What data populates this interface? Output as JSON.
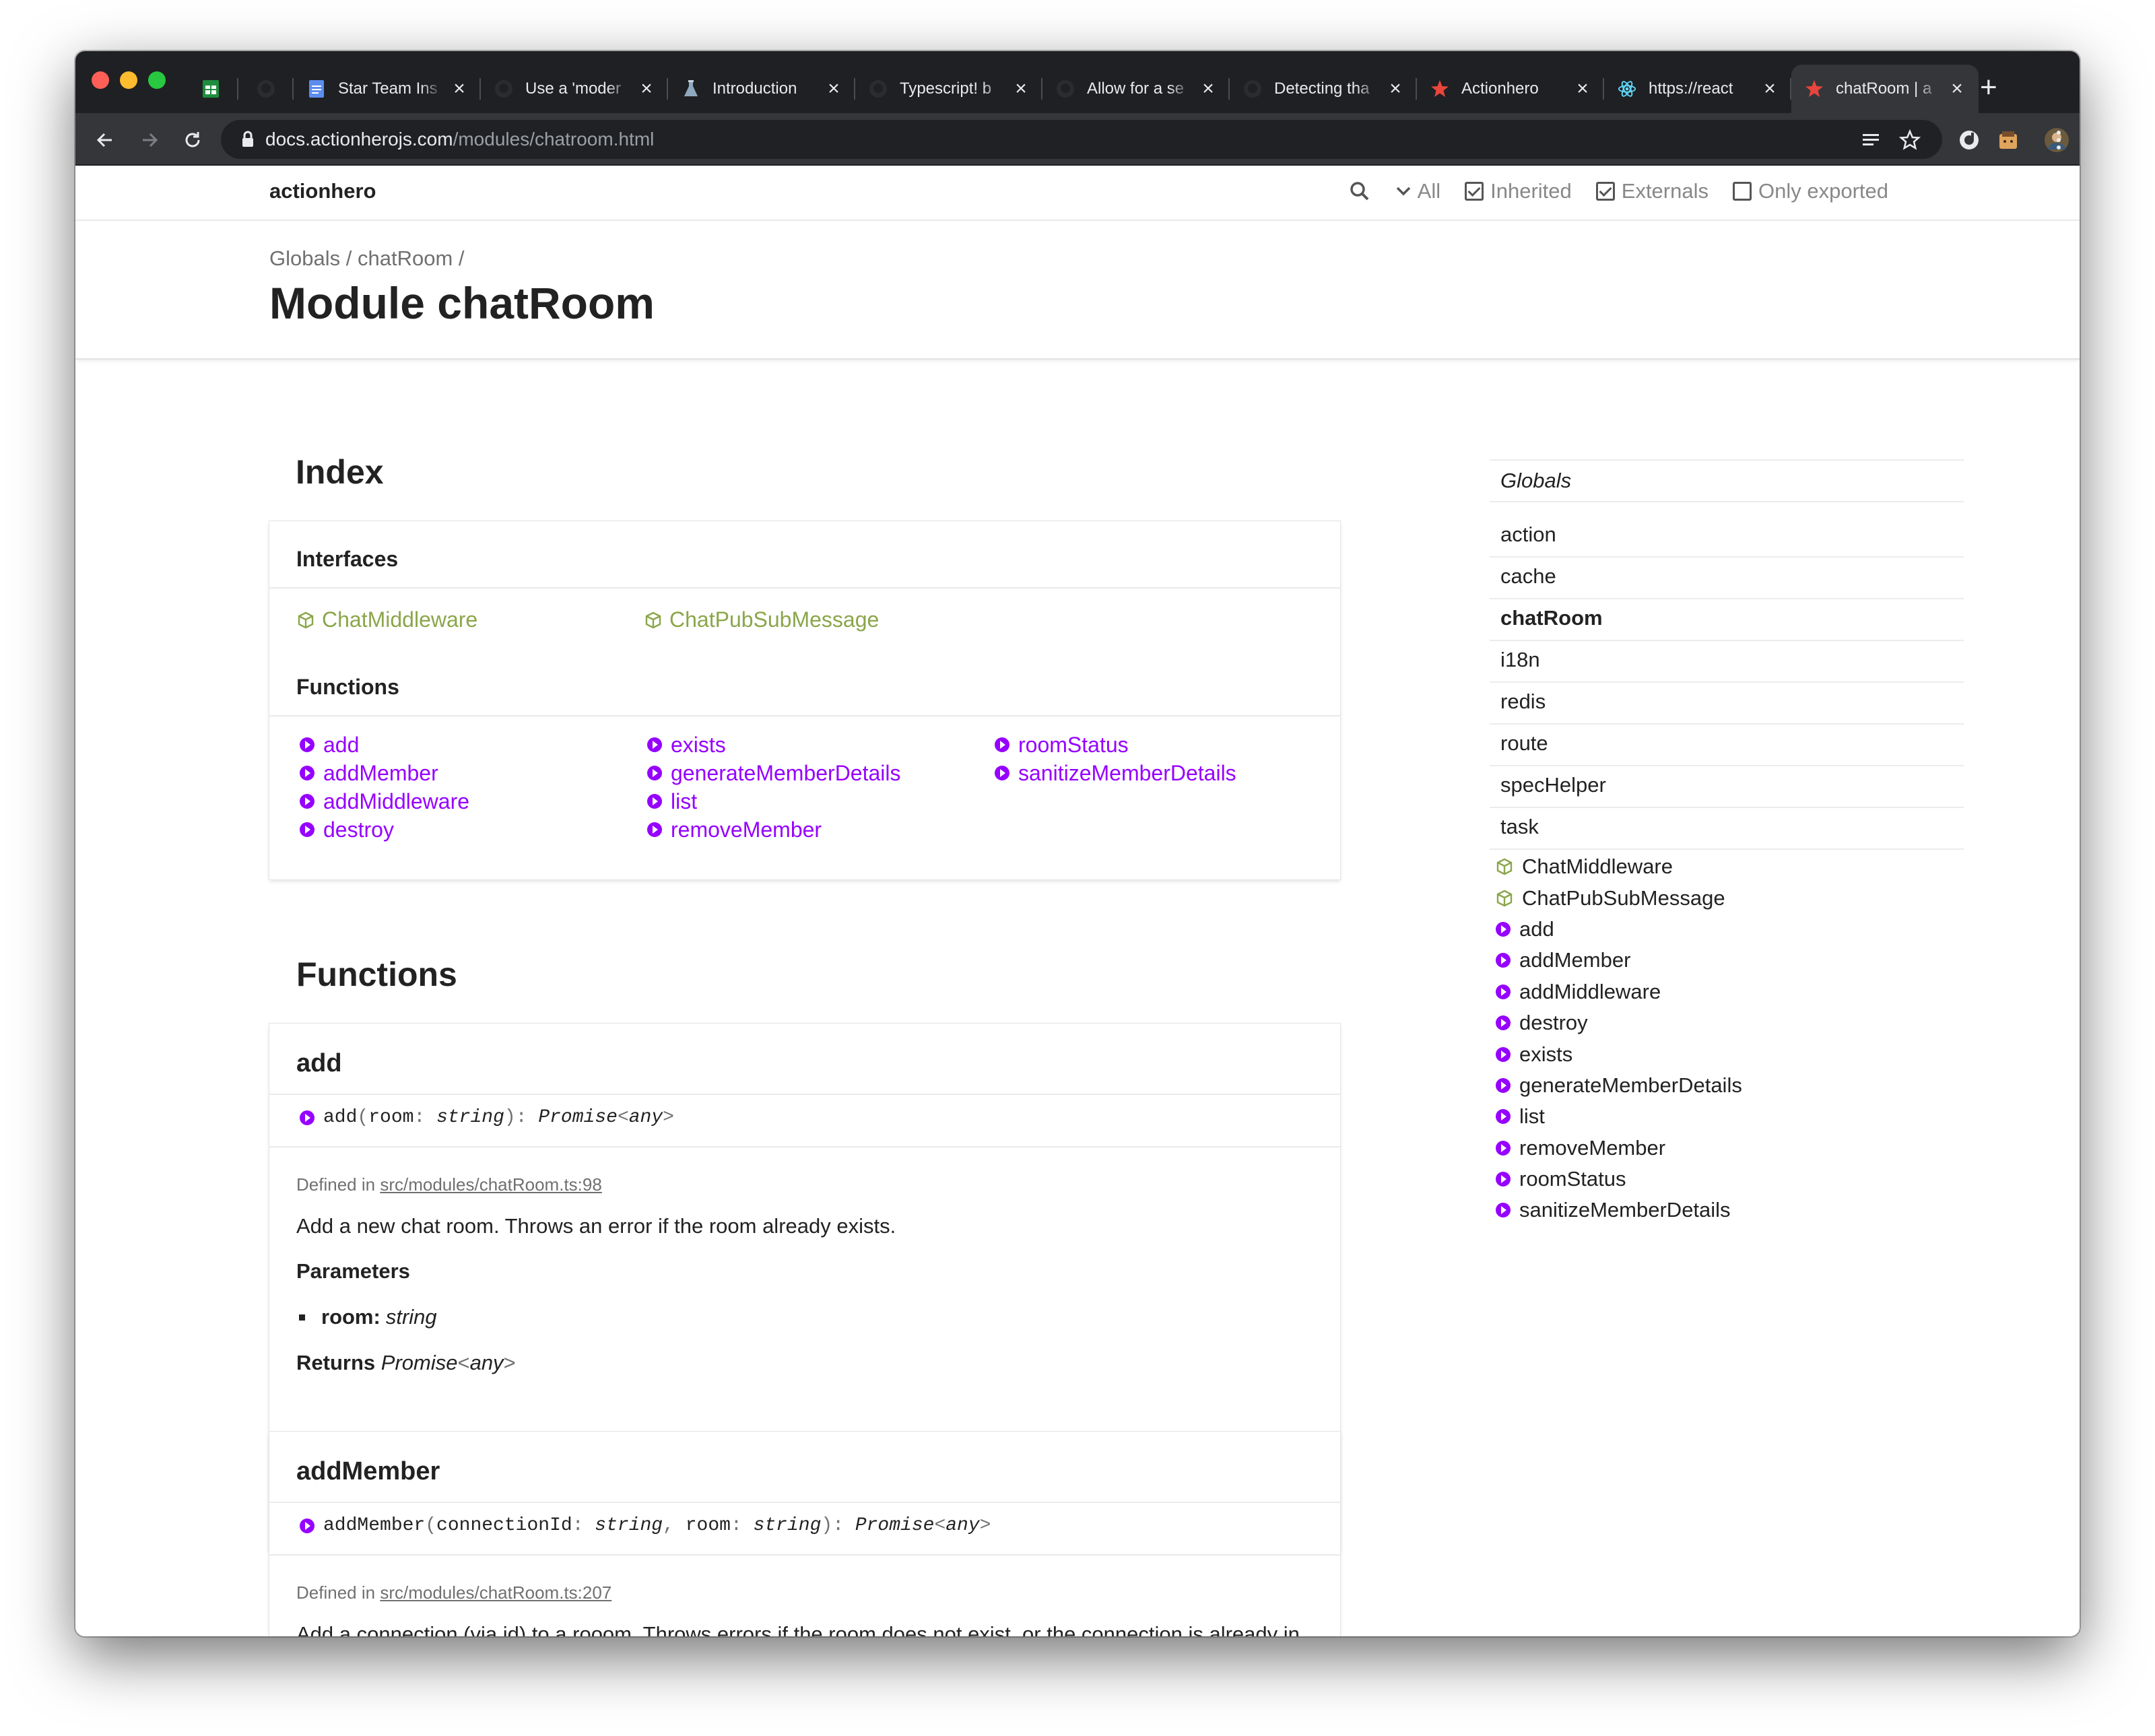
{
  "browser": {
    "tabs": [
      {
        "title": "",
        "icon": "sheets-icon",
        "pinned": true
      },
      {
        "title": "",
        "icon": "github-icon",
        "pinned": true
      },
      {
        "title": "Star Team Ins",
        "icon": "docs-icon"
      },
      {
        "title": "Use a 'moder",
        "icon": "github-icon"
      },
      {
        "title": "Introduction",
        "icon": "flask-icon"
      },
      {
        "title": "Typescript! b",
        "icon": "github-icon"
      },
      {
        "title": "Allow for a se",
        "icon": "github-icon"
      },
      {
        "title": "Detecting tha",
        "icon": "github-icon"
      },
      {
        "title": "Actionhero",
        "icon": "actionhero-star-icon"
      },
      {
        "title": "https://react",
        "icon": "react-icon"
      },
      {
        "title": "chatRoom | a",
        "icon": "actionhero-star-icon",
        "active": true
      }
    ],
    "url_host": "docs.actionherojs.com",
    "url_path": "/modules/chatroom.html"
  },
  "site": {
    "brand": "actionhero",
    "filter_label": "All",
    "options": [
      {
        "label": "Inherited",
        "checked": true
      },
      {
        "label": "Externals",
        "checked": true
      },
      {
        "label": "Only exported",
        "checked": false
      }
    ]
  },
  "header": {
    "crumb_globals": "Globals",
    "crumb_module": "chatRoom",
    "sep": "/",
    "title": "Module chatRoom"
  },
  "index": {
    "heading": "Index",
    "interfaces_title": "Interfaces",
    "interfaces": [
      "ChatMiddleware",
      "ChatPubSubMessage"
    ],
    "functions_title": "Functions",
    "functions_col1": [
      "add",
      "addMember",
      "addMiddleware",
      "destroy"
    ],
    "functions_col2": [
      "exists",
      "generateMemberDetails",
      "list",
      "removeMember"
    ],
    "functions_col3": [
      "roomStatus",
      "sanitizeMemberDetails"
    ]
  },
  "functions": {
    "heading": "Functions",
    "add": {
      "name": "add",
      "sig_name": "add",
      "sig_param": "room",
      "sig_type": "string",
      "sig_return": "Promise",
      "sig_generic": "any",
      "defined_label": "Defined in",
      "source": "src/modules/chatRoom.ts:98",
      "description": "Add a new chat room. Throws an error if the room already exists.",
      "params_title": "Parameters",
      "param_name": "room:",
      "param_type": "string",
      "returns_label": "Returns",
      "returns_type": "Promise",
      "returns_generic": "any"
    },
    "addMember": {
      "name": "addMember",
      "sig_name": "addMember",
      "sig_param1": "connectionId",
      "sig_type1": "string",
      "sig_param2": "room",
      "sig_type2": "string",
      "sig_return": "Promise",
      "sig_generic": "any",
      "defined_label": "Defined in",
      "source": "src/modules/chatRoom.ts:207",
      "description": "Add a connection (via id) to a rooom. Throws errors if the room does not exist, or the connection is already in the room. Middleware errors also throw."
    }
  },
  "sidebar": {
    "globals": "Globals",
    "modules": [
      "action",
      "cache",
      "chatRoom",
      "i18n",
      "redis",
      "route",
      "specHelper",
      "task"
    ],
    "current_module": "chatRoom",
    "interfaces": [
      "ChatMiddleware",
      "ChatPubSubMessage"
    ],
    "functions": [
      "add",
      "addMember",
      "addMiddleware",
      "destroy",
      "exists",
      "generateMemberDetails",
      "list",
      "removeMember",
      "roomStatus",
      "sanitizeMemberDetails"
    ]
  },
  "colors": {
    "link_function": "#9600ff",
    "link_interface": "#8ba64a",
    "tabstrip": "#1f2023",
    "toolbar": "#35363a"
  }
}
